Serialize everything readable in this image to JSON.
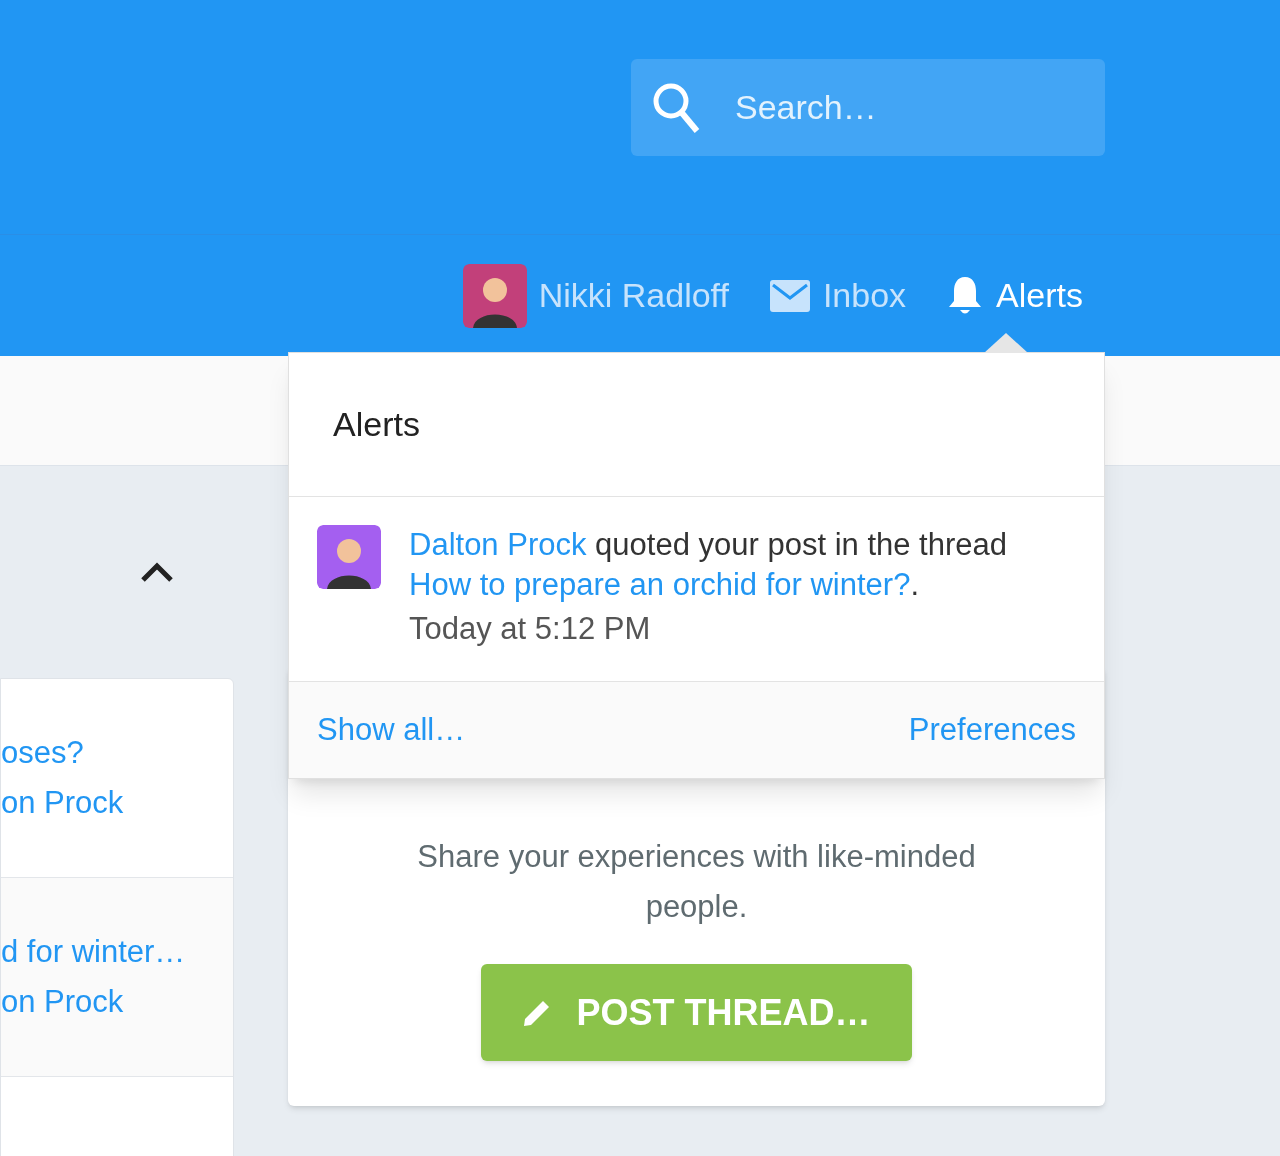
{
  "search": {
    "placeholder": "Search…"
  },
  "nav": [
    {
      "kind": "user",
      "label": "Nikki Radloff",
      "selected": false
    },
    {
      "kind": "inbox",
      "label": "Inbox",
      "selected": false
    },
    {
      "kind": "alerts",
      "label": "Alerts",
      "selected": true
    }
  ],
  "popup": {
    "title": "Alerts",
    "alerts": [
      {
        "user": "Dalton Prock",
        "text": "quoted your post in the thread",
        "thread": "How to prepare an orchid for winter?",
        "suffix": ".",
        "time": "Today at 5:12 PM"
      }
    ],
    "show_all": "Show all…",
    "preferences": "Preferences"
  },
  "sidebar": {
    "threads": [
      {
        "title": "oses?",
        "author": "on Prock"
      },
      {
        "title": "d for winter…",
        "author": "on Prock"
      }
    ]
  },
  "cta": {
    "text": "Share your experiences with like-minded people.",
    "button": "POST THREAD…"
  }
}
